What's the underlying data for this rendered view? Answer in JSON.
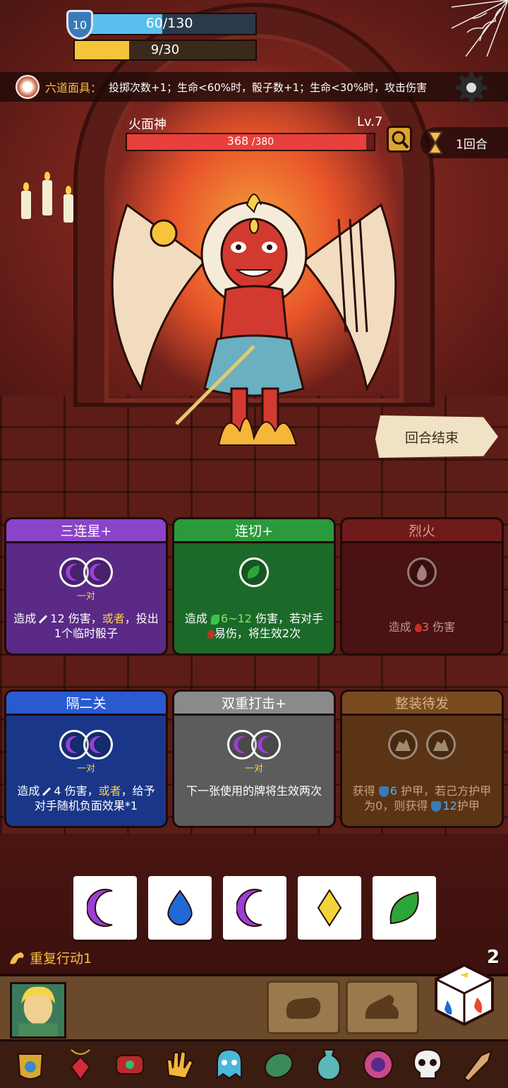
{
  "mask": {
    "title": "六道面具：",
    "description": "投掷次数+1；生命<60%时，骰子数+1；生命<30%时，攻击伤害"
  },
  "boss": {
    "name": "火面神",
    "level": "Lv.7",
    "hp_current": "368",
    "hp_max": " /380",
    "hp_fraction": 0.968
  },
  "round": {
    "label": "1回合"
  },
  "end_turn": {
    "label": "回合结束"
  },
  "cards": [
    {
      "title": "三连星+",
      "slot_label": "一对",
      "desc_prefix": "造成",
      "desc_value": "12 伤害，",
      "desc_or": "或者",
      "desc_suffix": "，投出1个临时骰子"
    },
    {
      "title": "连切+",
      "desc_prefix": "造成",
      "desc_value": "6~12",
      "desc_mid": " 伤害，若对手",
      "desc_suffix": "易伤，将生效2次"
    },
    {
      "title": "烈火",
      "desc_prefix": "造成",
      "desc_value": "3",
      "desc_suffix": " 伤害"
    },
    {
      "title": "隔二关",
      "slot_label": "一对",
      "desc_prefix": "造成",
      "desc_value": "4 伤害，",
      "desc_or": "或者",
      "desc_suffix": "，给予对手随机负面效果*1"
    },
    {
      "title": "双重打击+",
      "slot_label": "一对",
      "desc": "下一张使用的牌将生效两次"
    },
    {
      "title": "整装待发",
      "desc_prefix": "获得",
      "desc_value1": "6",
      "desc_mid": " 护甲，若己方护甲为0，则获得",
      "desc_value2": "12",
      "desc_suffix": "护甲"
    }
  ],
  "dice": [
    "moon",
    "water",
    "moon",
    "diamond",
    "leaf"
  ],
  "colors": {
    "moon": "#9a3fd6",
    "water": "#1e6ad6",
    "diamond": "#f2d43a",
    "leaf": "#2aa63a"
  },
  "player": {
    "repeat_action": "重复行动1",
    "armor_level": "10",
    "hp_text": "60/130",
    "hp_fraction": 0.46,
    "xp_text": "9/30",
    "xp_fraction": 0.3,
    "dice_count": "2"
  },
  "relics": [
    "armor-icon",
    "ruby-amulet-icon",
    "red-bracelet-icon",
    "golden-hand-icon",
    "ghost-icon",
    "turtle-shell-icon",
    "teal-vase-icon",
    "portal-ring-icon",
    "skull-icon",
    "horn-icon"
  ]
}
